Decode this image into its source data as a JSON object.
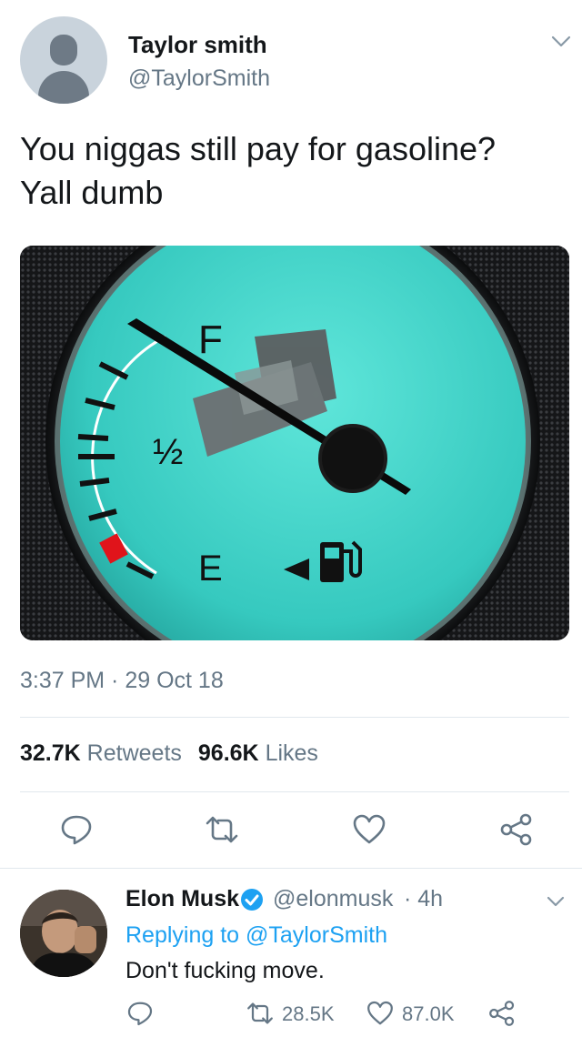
{
  "tweet": {
    "author_name": "Taylor smith",
    "author_handle": "@TaylorSmith",
    "text_line1": "You niggas still pay for gasoline?",
    "text_line2": "Yall dumb",
    "timestamp": "3:37 PM · 29 Oct 18",
    "retweets_count": "32.7K",
    "retweets_label": "Retweets",
    "likes_count": "96.6K",
    "likes_label": "Likes",
    "media": {
      "gauge_full_label": "F",
      "gauge_half_label": "½",
      "gauge_empty_label": "E"
    }
  },
  "reply": {
    "author_name": "Elon Musk",
    "author_handle": "@elonmusk",
    "time": "· 4h",
    "replying_to": "Replying to @TaylorSmith",
    "text": "Don't fucking move.",
    "retweets_count": "28.5K",
    "likes_count": "87.0K"
  },
  "colors": {
    "accent": "#1da1f2",
    "secondary_text": "#657786",
    "gauge_teal": "#3fd2c8"
  },
  "icons": [
    "caret-down-icon",
    "reply-icon",
    "retweet-icon",
    "like-icon",
    "share-icon",
    "verified-badge-icon",
    "fuel-pump-icon"
  ]
}
